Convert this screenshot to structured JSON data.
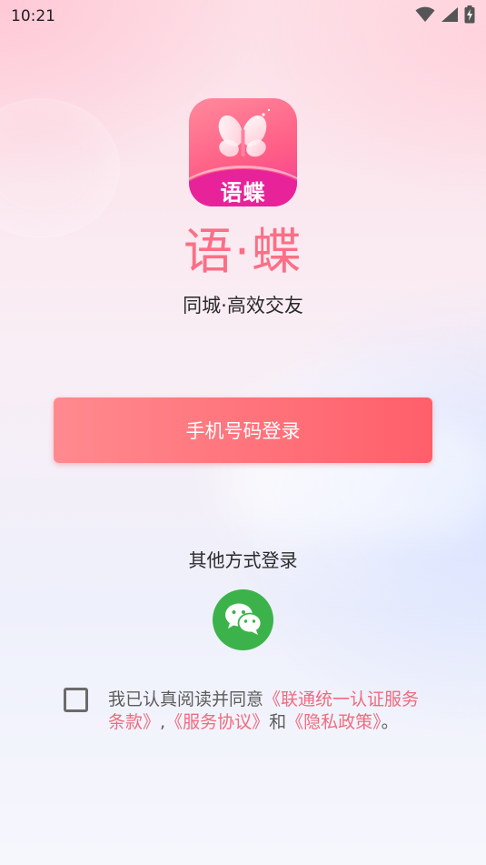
{
  "status_bar": {
    "time": "10:21",
    "icons": [
      "wifi-icon",
      "signal-icon",
      "battery-icon"
    ]
  },
  "app": {
    "logo_text": "语蝶",
    "title": "语·蝶",
    "slogan": "同城·高效交友"
  },
  "login": {
    "phone_button_label": "手机号码登录",
    "other_methods_label": "其他方式登录",
    "other_methods": [
      "wechat-icon"
    ]
  },
  "agreement": {
    "checked": false,
    "prefix": "我已认真阅读并同意",
    "link_unicom": "《联通统一认证服务条款》",
    "sep1": ",",
    "link_service": "《服务协议》",
    "conj": "和",
    "link_privacy": "《隐私政策》",
    "suffix": "。"
  },
  "colors": {
    "accent": "#fb6f86",
    "button_start": "#ff8a8f",
    "button_end": "#ff5f6a",
    "wechat": "#3cb34a",
    "link": "#f06b7d"
  }
}
